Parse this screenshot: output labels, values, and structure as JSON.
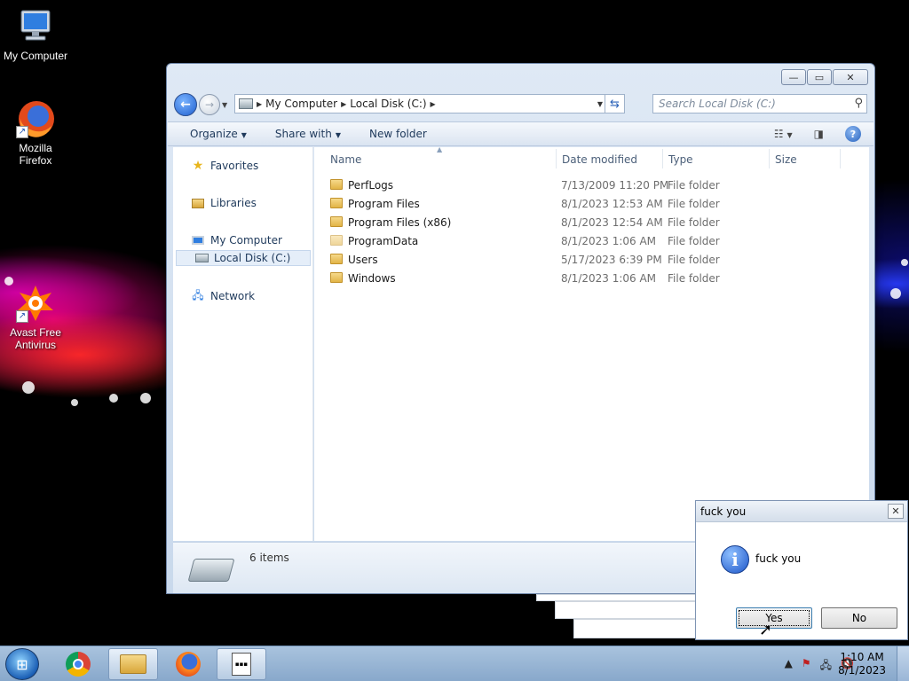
{
  "desktop": {
    "icons": [
      {
        "label": "My Computer"
      },
      {
        "label": "Mozilla Firefox"
      },
      {
        "label": "Avast Free Antivirus"
      }
    ]
  },
  "explorer": {
    "breadcrumb": [
      "My Computer",
      "Local Disk (C:)"
    ],
    "search_placeholder": "Search Local Disk (C:)",
    "toolbar": {
      "organize": "Organize",
      "share_with": "Share with",
      "new_folder": "New folder"
    },
    "nav": {
      "favorites": "Favorites",
      "libraries": "Libraries",
      "my_computer": "My Computer",
      "local_disk": "Local Disk (C:)",
      "network": "Network"
    },
    "columns": {
      "name": "Name",
      "date_modified": "Date modified",
      "type": "Type",
      "size": "Size"
    },
    "files": [
      {
        "name": "PerfLogs",
        "date": "7/13/2009 11:20 PM",
        "type": "File folder"
      },
      {
        "name": "Program Files",
        "date": "8/1/2023 12:53 AM",
        "type": "File folder"
      },
      {
        "name": "Program Files (x86)",
        "date": "8/1/2023 12:54 AM",
        "type": "File folder"
      },
      {
        "name": "ProgramData",
        "date": "8/1/2023 1:06 AM",
        "type": "File folder"
      },
      {
        "name": "Users",
        "date": "5/17/2023 6:39 PM",
        "type": "File folder"
      },
      {
        "name": "Windows",
        "date": "8/1/2023 1:06 AM",
        "type": "File folder"
      }
    ],
    "status": "6 items"
  },
  "msgbox": {
    "title": "fuck you",
    "message": "fuck you",
    "yes": "Yes",
    "no": "No"
  },
  "taskbar": {
    "time": "1:10 AM",
    "date": "8/1/2023"
  }
}
